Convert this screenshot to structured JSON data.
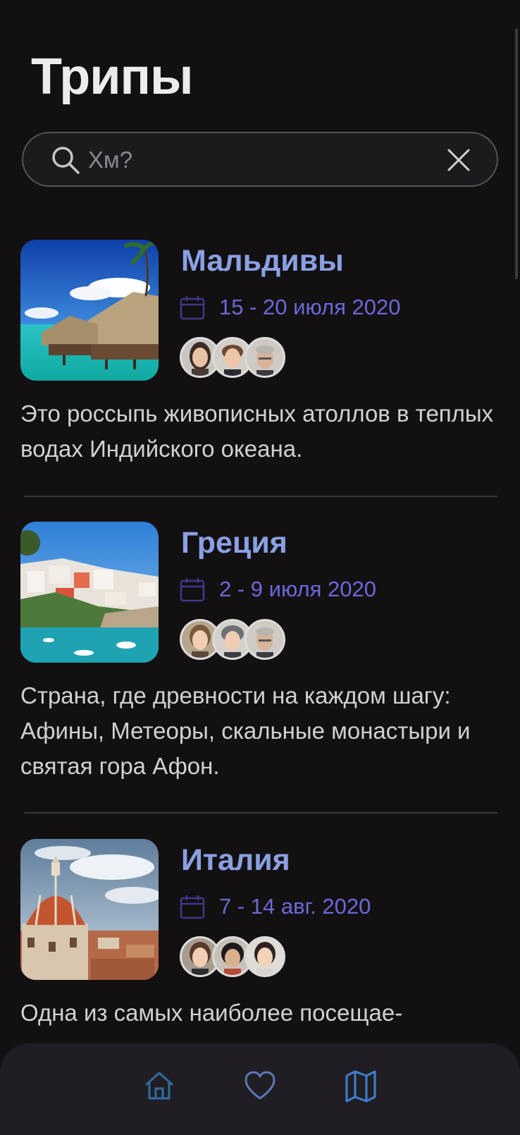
{
  "page": {
    "title": "Трипы"
  },
  "search": {
    "placeholder": "Хм?"
  },
  "trips": [
    {
      "name": "Мальдивы",
      "date": "15 - 20 июля 2020",
      "description": "Это россыпь живописных атоллов в теплых водах Индийского океана.",
      "photo": "maldives-photo"
    },
    {
      "name": "Греция",
      "date": "2 - 9 июля 2020",
      "description": "Страна, где древности на каждом шагу: Афины, Метеоры, скальные монастыри и святая гора Афон.",
      "photo": "greece-photo"
    },
    {
      "name": "Италия",
      "date": "7 - 14 авг. 2020",
      "description": "Одна из самых наиболее посещае-",
      "photo": "italy-photo"
    }
  ],
  "bottom_nav": {
    "items": [
      {
        "icon": "home-icon"
      },
      {
        "icon": "heart-icon"
      },
      {
        "icon": "map-icon"
      }
    ]
  },
  "colors": {
    "background": "#131012",
    "trip_name": "#8aa0e2",
    "date": "#6c69d8",
    "nav_home": "#2e6da0",
    "nav_heart": "#5a78b8",
    "nav_map": "#3f7fd0"
  }
}
